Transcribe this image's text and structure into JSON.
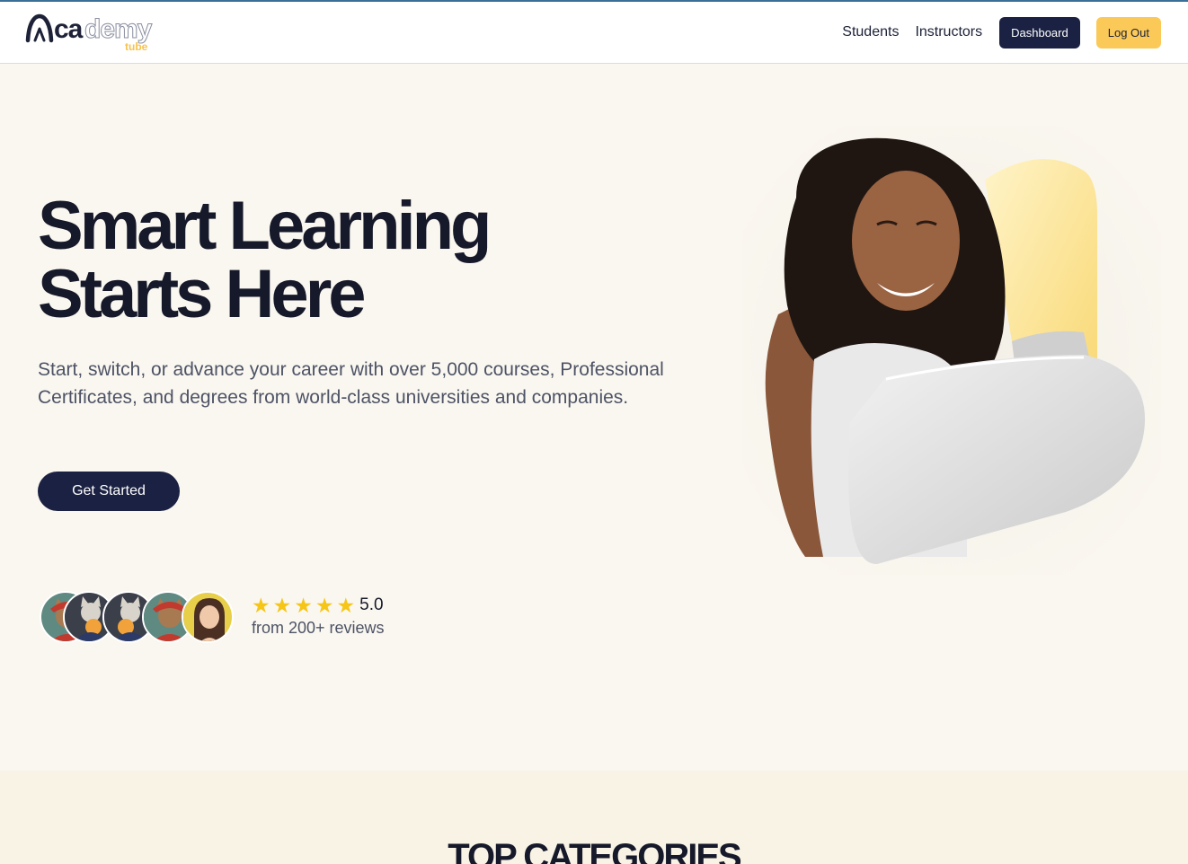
{
  "brand": {
    "logo_main": "ca",
    "logo_outline": "demy",
    "logo_sub": "tube",
    "accent": "#fbc957",
    "primary": "#1b2142"
  },
  "nav": {
    "links": [
      "Students",
      "Instructors"
    ],
    "dashboard_label": "Dashboard",
    "logout_label": "Log Out"
  },
  "hero": {
    "title_line1": "Smart Learning",
    "title_line2": "Starts Here",
    "subtitle": "Start, switch, or advance your career with over 5,000 courses, Professional Certificates, and degrees from world-class universities and companies.",
    "cta_label": "Get Started",
    "image_icon": "student-with-laptop-photo"
  },
  "rating": {
    "stars": 5,
    "score": "5.0",
    "reviews_text": "from 200+ reviews",
    "avatar_count": 5
  },
  "categories": {
    "title": "TOP CATEGORIES"
  }
}
